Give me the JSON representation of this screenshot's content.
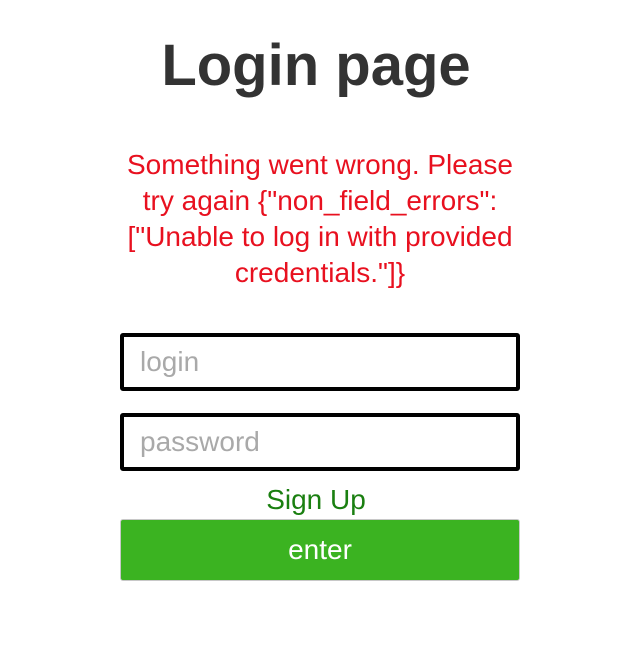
{
  "page": {
    "title": "Login page"
  },
  "error": {
    "message": "Something went wrong. Please\ntry again {\"non_field_errors\":\n[\"Unable to log in with provided\ncredentials.\"]}"
  },
  "form": {
    "login": {
      "value": "",
      "placeholder": "login"
    },
    "password": {
      "value": "",
      "placeholder": "password"
    },
    "signup_label": "Sign Up",
    "enter_label": "enter"
  },
  "colors": {
    "error_text": "#e8101f",
    "signup_link": "#1a7f10",
    "enter_button_bg": "#3bb321",
    "title_text": "#333333"
  }
}
